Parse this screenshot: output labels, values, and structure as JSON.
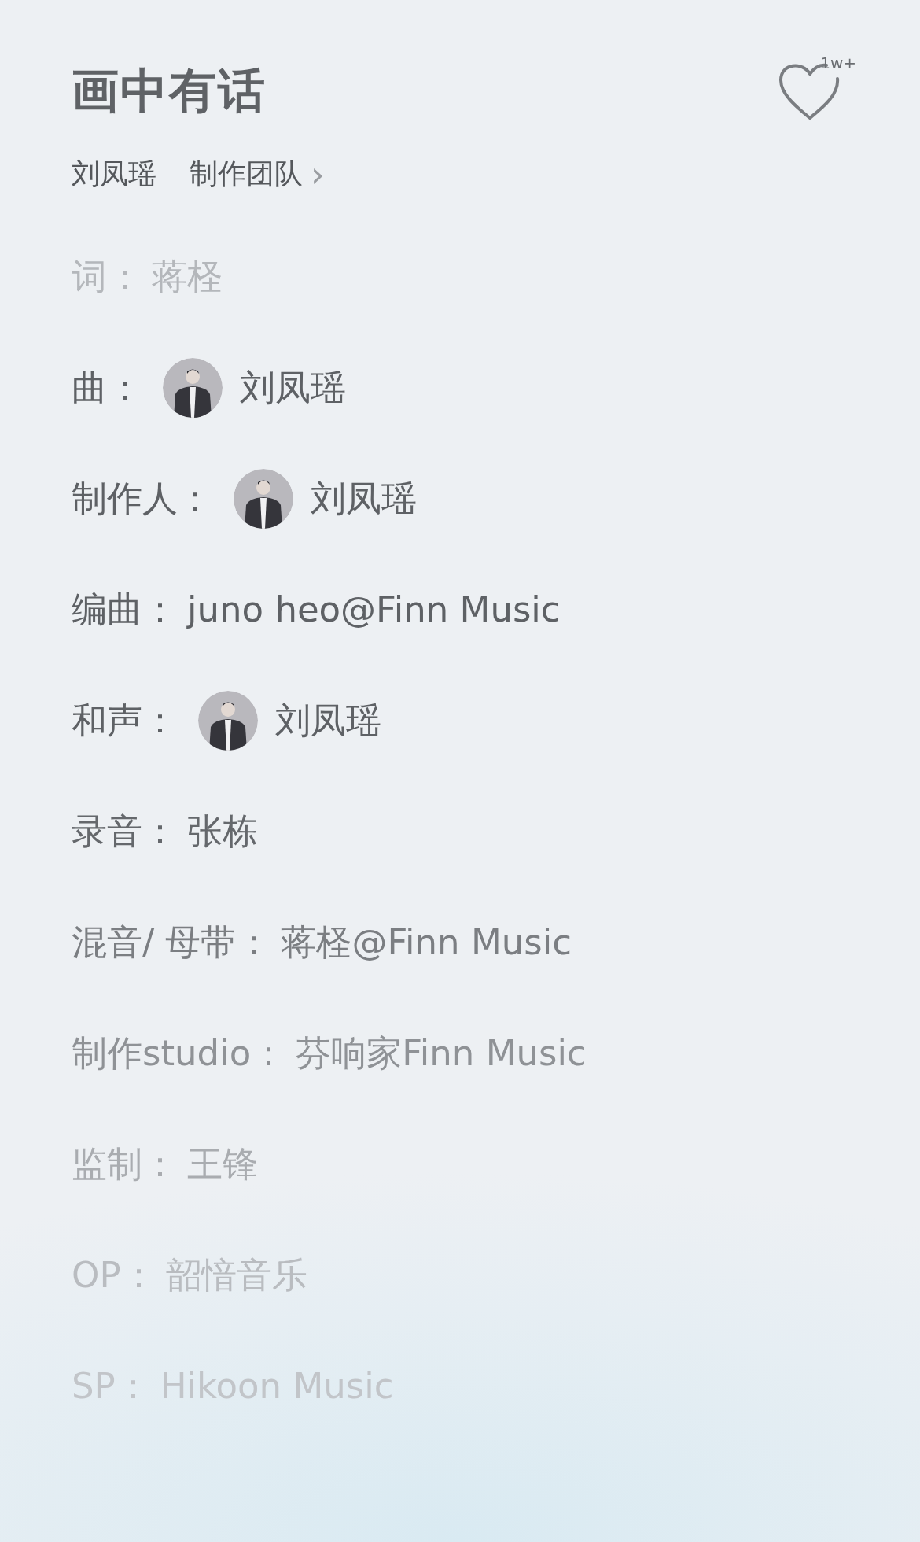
{
  "song": {
    "title": "画中有话",
    "artist": "刘凤瑶",
    "team_link": "制作团队",
    "chevron": "›"
  },
  "like": {
    "count": "1w+"
  },
  "credits": [
    {
      "role": "词：",
      "name": "蒋柽",
      "avatar": false,
      "color": "#b4b7bb"
    },
    {
      "role": "曲：",
      "name": "刘凤瑶",
      "avatar": true,
      "color": "#5e6165"
    },
    {
      "role": "制作人：",
      "name": "刘凤瑶",
      "avatar": true,
      "color": "#5e6165"
    },
    {
      "role": "编曲：",
      "name": "juno heo@Finn Music",
      "avatar": false,
      "color": "#5e6165"
    },
    {
      "role": "和声：",
      "name": "刘凤瑶",
      "avatar": true,
      "color": "#5e6165"
    },
    {
      "role": "录音：",
      "name": "张栋",
      "avatar": false,
      "color": "#65686c"
    },
    {
      "role": "混音/ 母带：",
      "name": "蒋柽@Finn Music",
      "avatar": false,
      "color": "#7b7e82"
    },
    {
      "role": "制作studio：",
      "name": "芬响家Finn Music",
      "avatar": false,
      "color": "#8f9296"
    },
    {
      "role": "监制：",
      "name": "王锋",
      "avatar": false,
      "color": "#a9acb0"
    },
    {
      "role": "OP：",
      "name": "韶愔音乐",
      "avatar": false,
      "color": "#b9bcc0"
    },
    {
      "role": "SP：",
      "name": "Hikoon Music",
      "avatar": false,
      "color": "#c2c5c9"
    }
  ]
}
